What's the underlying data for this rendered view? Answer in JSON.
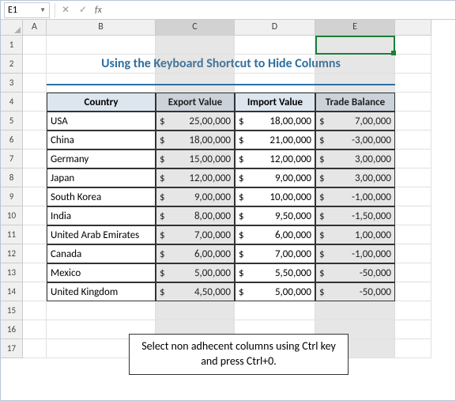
{
  "nameBox": "E1",
  "formula": "",
  "columns": [
    "A",
    "B",
    "C",
    "D",
    "E"
  ],
  "rowNums": [
    "1",
    "2",
    "3",
    "4",
    "5",
    "6",
    "7",
    "8",
    "9",
    "10",
    "11",
    "12",
    "13",
    "14",
    "15",
    "16",
    "17"
  ],
  "title": "Using the Keyboard Shortcut to Hide Columns",
  "headers": {
    "country": "Country",
    "export": "Export Value",
    "import": "Import Value",
    "balance": "Trade Balance"
  },
  "rows": [
    {
      "c": "USA",
      "e": "25,00,000",
      "i": "18,00,000",
      "b": "7,00,000"
    },
    {
      "c": "China",
      "e": "18,00,000",
      "i": "21,00,000",
      "b": "-3,00,000"
    },
    {
      "c": "Germany",
      "e": "15,00,000",
      "i": "12,00,000",
      "b": "3,00,000"
    },
    {
      "c": "Japan",
      "e": "12,00,000",
      "i": "9,00,000",
      "b": "3,00,000"
    },
    {
      "c": "South Korea",
      "e": "9,00,000",
      "i": "10,00,000",
      "b": "-1,00,000"
    },
    {
      "c": "India",
      "e": "8,00,000",
      "i": "9,50,000",
      "b": "-1,50,000"
    },
    {
      "c": "United Arab Emirates",
      "e": "7,00,000",
      "i": "6,00,000",
      "b": "1,00,000"
    },
    {
      "c": "Canada",
      "e": "6,00,000",
      "i": "7,00,000",
      "b": "-1,00,000"
    },
    {
      "c": "Mexico",
      "e": "5,00,000",
      "i": "5,50,000",
      "b": "-50,000"
    },
    {
      "c": "United Kingdom",
      "e": "4,50,000",
      "i": "5,00,000",
      "b": "-50,000"
    }
  ],
  "currency": "$",
  "callout": "Select non adhecent columns using Ctrl key and press Ctrl+0.",
  "chart_data": {
    "type": "table",
    "title": "Using the Keyboard Shortcut to Hide Columns",
    "columns": [
      "Country",
      "Export Value",
      "Import Value",
      "Trade Balance"
    ],
    "data": [
      [
        "USA",
        2500000,
        1800000,
        700000
      ],
      [
        "China",
        1800000,
        2100000,
        -300000
      ],
      [
        "Germany",
        1500000,
        1200000,
        300000
      ],
      [
        "Japan",
        1200000,
        900000,
        300000
      ],
      [
        "South Korea",
        900000,
        1000000,
        -100000
      ],
      [
        "India",
        800000,
        950000,
        -150000
      ],
      [
        "United Arab Emirates",
        700000,
        600000,
        100000
      ],
      [
        "Canada",
        600000,
        700000,
        -100000
      ],
      [
        "Mexico",
        500000,
        550000,
        -50000
      ],
      [
        "United Kingdom",
        450000,
        500000,
        -50000
      ]
    ]
  }
}
